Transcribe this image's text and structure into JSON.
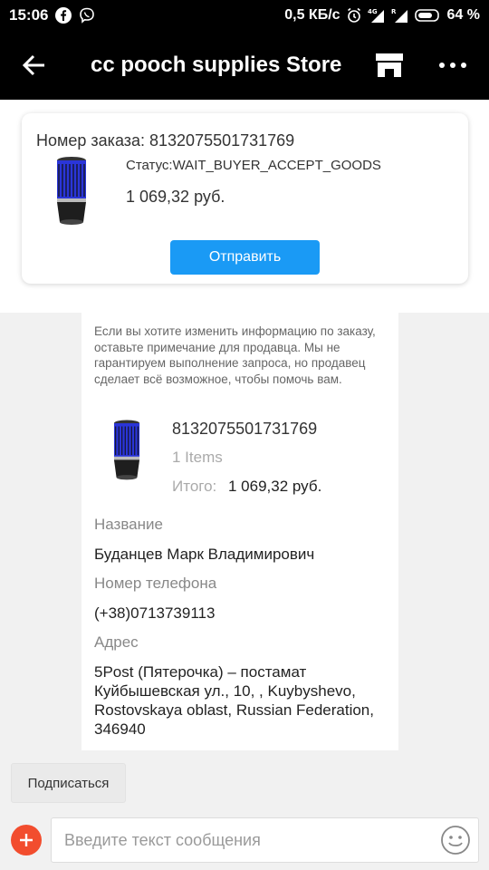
{
  "status_bar": {
    "time": "15:06",
    "speed": "0,5 КБ/с",
    "battery": "64 %",
    "net_4g": "4G",
    "net_r": "R"
  },
  "app_bar": {
    "title": "cc pooch supplies Store",
    "icons": [
      "back-arrow-icon",
      "store-icon",
      "more-icon"
    ]
  },
  "order_card": {
    "order_number": "Номер заказа: 8132075501731769",
    "status": "Статус:WAIT_BUYER_ACCEPT_GOODS",
    "price": "1 069,32 руб.",
    "send_label": "Отправить",
    "accent": "#1a9af5"
  },
  "message": {
    "note": "Если вы хотите изменить информацию по заказу, оставьте примечание для продавца. Мы не гарантируем выполнение запроса, но продавец сделает всё возможное, чтобы помочь вам.",
    "order_number": "8132075501731769",
    "items": "1 Items",
    "total_label": "Итого:",
    "total": "1 069,32 руб.",
    "name_label": "Название",
    "name_value": "Буданцев Марк Владимирович",
    "phone_label": "Номер телефона",
    "phone_value": "(+38)0713739113",
    "address_label": "Адрес",
    "address_value": "5Post (Пятерочка) – постамат Куйбышевская ул., 10, , Kuybyshevo, Rostovskaya oblast, Russian Federation, 346940"
  },
  "bottom": {
    "subscribe_label": "Подписаться",
    "input_placeholder": "Введите текст сообщения",
    "plus_color": "#f24d2e"
  }
}
